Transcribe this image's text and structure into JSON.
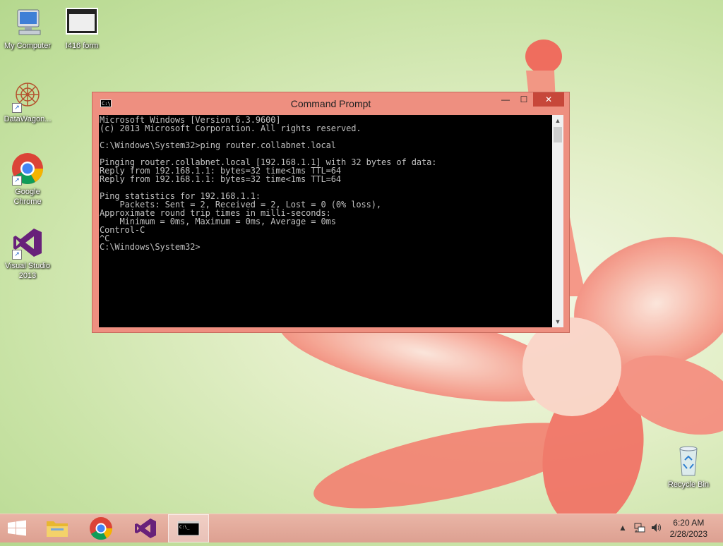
{
  "desktop": {
    "icons": [
      {
        "label": "My Computer"
      },
      {
        "label": "I416 form"
      },
      {
        "label": "DataWagon..."
      },
      {
        "label": "Google Chrome"
      },
      {
        "label": "Visual Studio 2013"
      },
      {
        "label": "Recycle Bin"
      }
    ]
  },
  "window": {
    "title": "Command Prompt",
    "icon_text": "C:\\",
    "minimize": "—",
    "maximize": "☐",
    "close": "✕",
    "console_lines": "Microsoft Windows [Version 6.3.9600]\n(c) 2013 Microsoft Corporation. All rights reserved.\n\nC:\\Windows\\System32>ping router.collabnet.local\n\nPinging router.collabnet.local [192.168.1.1] with 32 bytes of data:\nReply from 192.168.1.1: bytes=32 time<1ms TTL=64\nReply from 192.168.1.1: bytes=32 time<1ms TTL=64\n\nPing statistics for 192.168.1.1:\n    Packets: Sent = 2, Received = 2, Lost = 0 (0% loss),\nApproximate round trip times in milli-seconds:\n    Minimum = 0ms, Maximum = 0ms, Average = 0ms\nControl-C\n^C\nC:\\Windows\\System32>"
  },
  "taskbar": {
    "start_icon": "windows-logo",
    "pinned": [
      "file-explorer",
      "google-chrome",
      "visual-studio",
      "command-prompt"
    ],
    "tray_arrow": "▲",
    "clock": {
      "time": "6:20 AM",
      "date": "2/28/2023"
    }
  }
}
